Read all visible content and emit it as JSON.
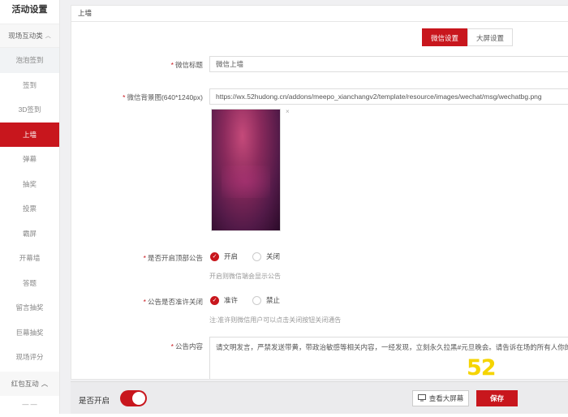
{
  "sidebar": {
    "title": "活动设置",
    "group1": "现场互动类",
    "items": [
      "泡泡签到",
      "签到",
      "3D签到",
      "上墙",
      "弹幕",
      "抽奖",
      "投票",
      "霸屏",
      "开幕墙",
      "答题",
      "留言抽奖",
      "巨幕抽奖",
      "现场评分"
    ],
    "active_index": 3,
    "group2": "红包互动",
    "more": "— —"
  },
  "main": {
    "header": "上墙",
    "tabs": [
      {
        "label": "微信设置",
        "active": true
      },
      {
        "label": "大屏设置",
        "active": false
      }
    ],
    "wechat_title": {
      "label": "微信标题",
      "value": "微信上墙"
    },
    "wechat_bg": {
      "label": "微信背景图(640*1240px)",
      "value": "https://wx.52hudong.cn/addons/meepo_xianchangv2/template/resource/images/wechat/msg/wechatbg.png",
      "remove": "×"
    },
    "top_notice": {
      "label": "是否开启顶部公告",
      "opt_on": "开启",
      "opt_off": "关闭",
      "hint": "开启则微信端会显示公告",
      "enabled": true
    },
    "allow_close": {
      "label": "公告是否准许关闭",
      "opt_on": "准许",
      "opt_off": "禁止",
      "hint": "注:准许则微信用户可以点击关闭按钮关闭通告",
      "allowed": true
    },
    "notice_content": {
      "label": "公告内容",
      "value": "请文明发言，严禁发送带黄，带政治敏感等相关内容，一经发现，立刻永久拉黑#元旦晚会。请告诉在场的所有人你的心声"
    },
    "watermark": "52"
  },
  "footer": {
    "toggle_label": "是否开启",
    "toggle_on": true,
    "view_screen": "查看大屏幕",
    "save": "保存"
  },
  "colors": {
    "accent": "#c8161d",
    "logo": "#f5d400"
  }
}
